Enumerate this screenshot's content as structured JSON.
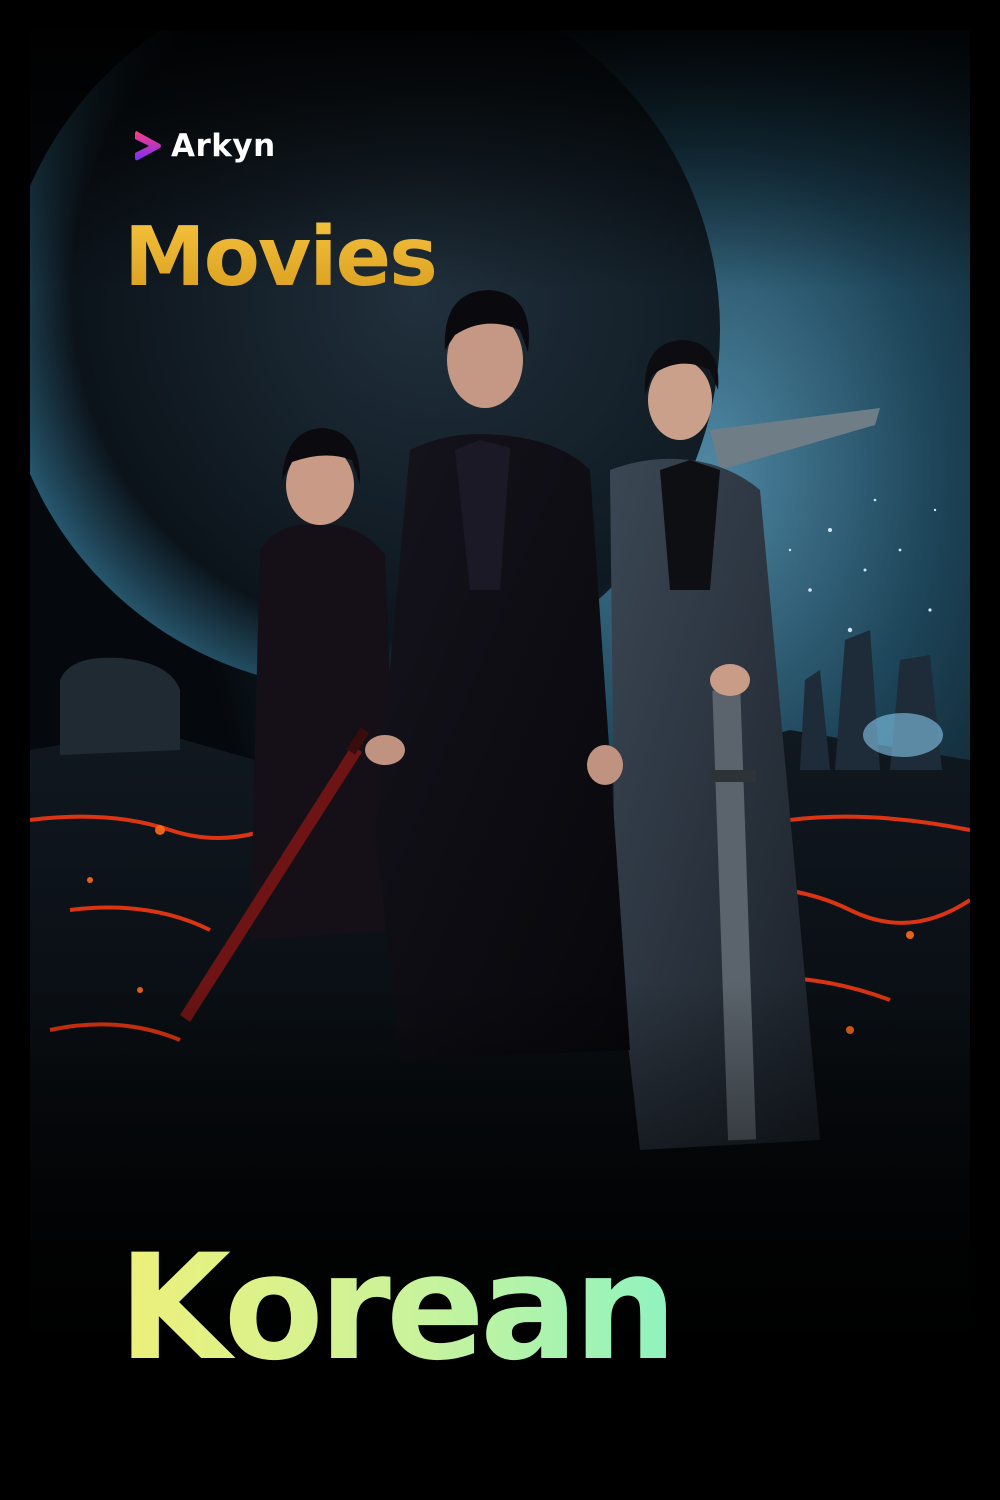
{
  "brand": {
    "name": "Arkyn",
    "icon": "play-chevron-icon",
    "colors": {
      "icon_top": "#ff3d7f",
      "icon_bottom": "#7b2ff7"
    }
  },
  "poster": {
    "category": "Movies",
    "title": "Korean",
    "colors": {
      "background": "#000000",
      "category_gold": "#e3a728",
      "title_gradient_start": "#eef07a",
      "title_gradient_end": "#8ff3bf",
      "lava": "#ff3b12",
      "night_sky": "#1f4a63"
    }
  }
}
